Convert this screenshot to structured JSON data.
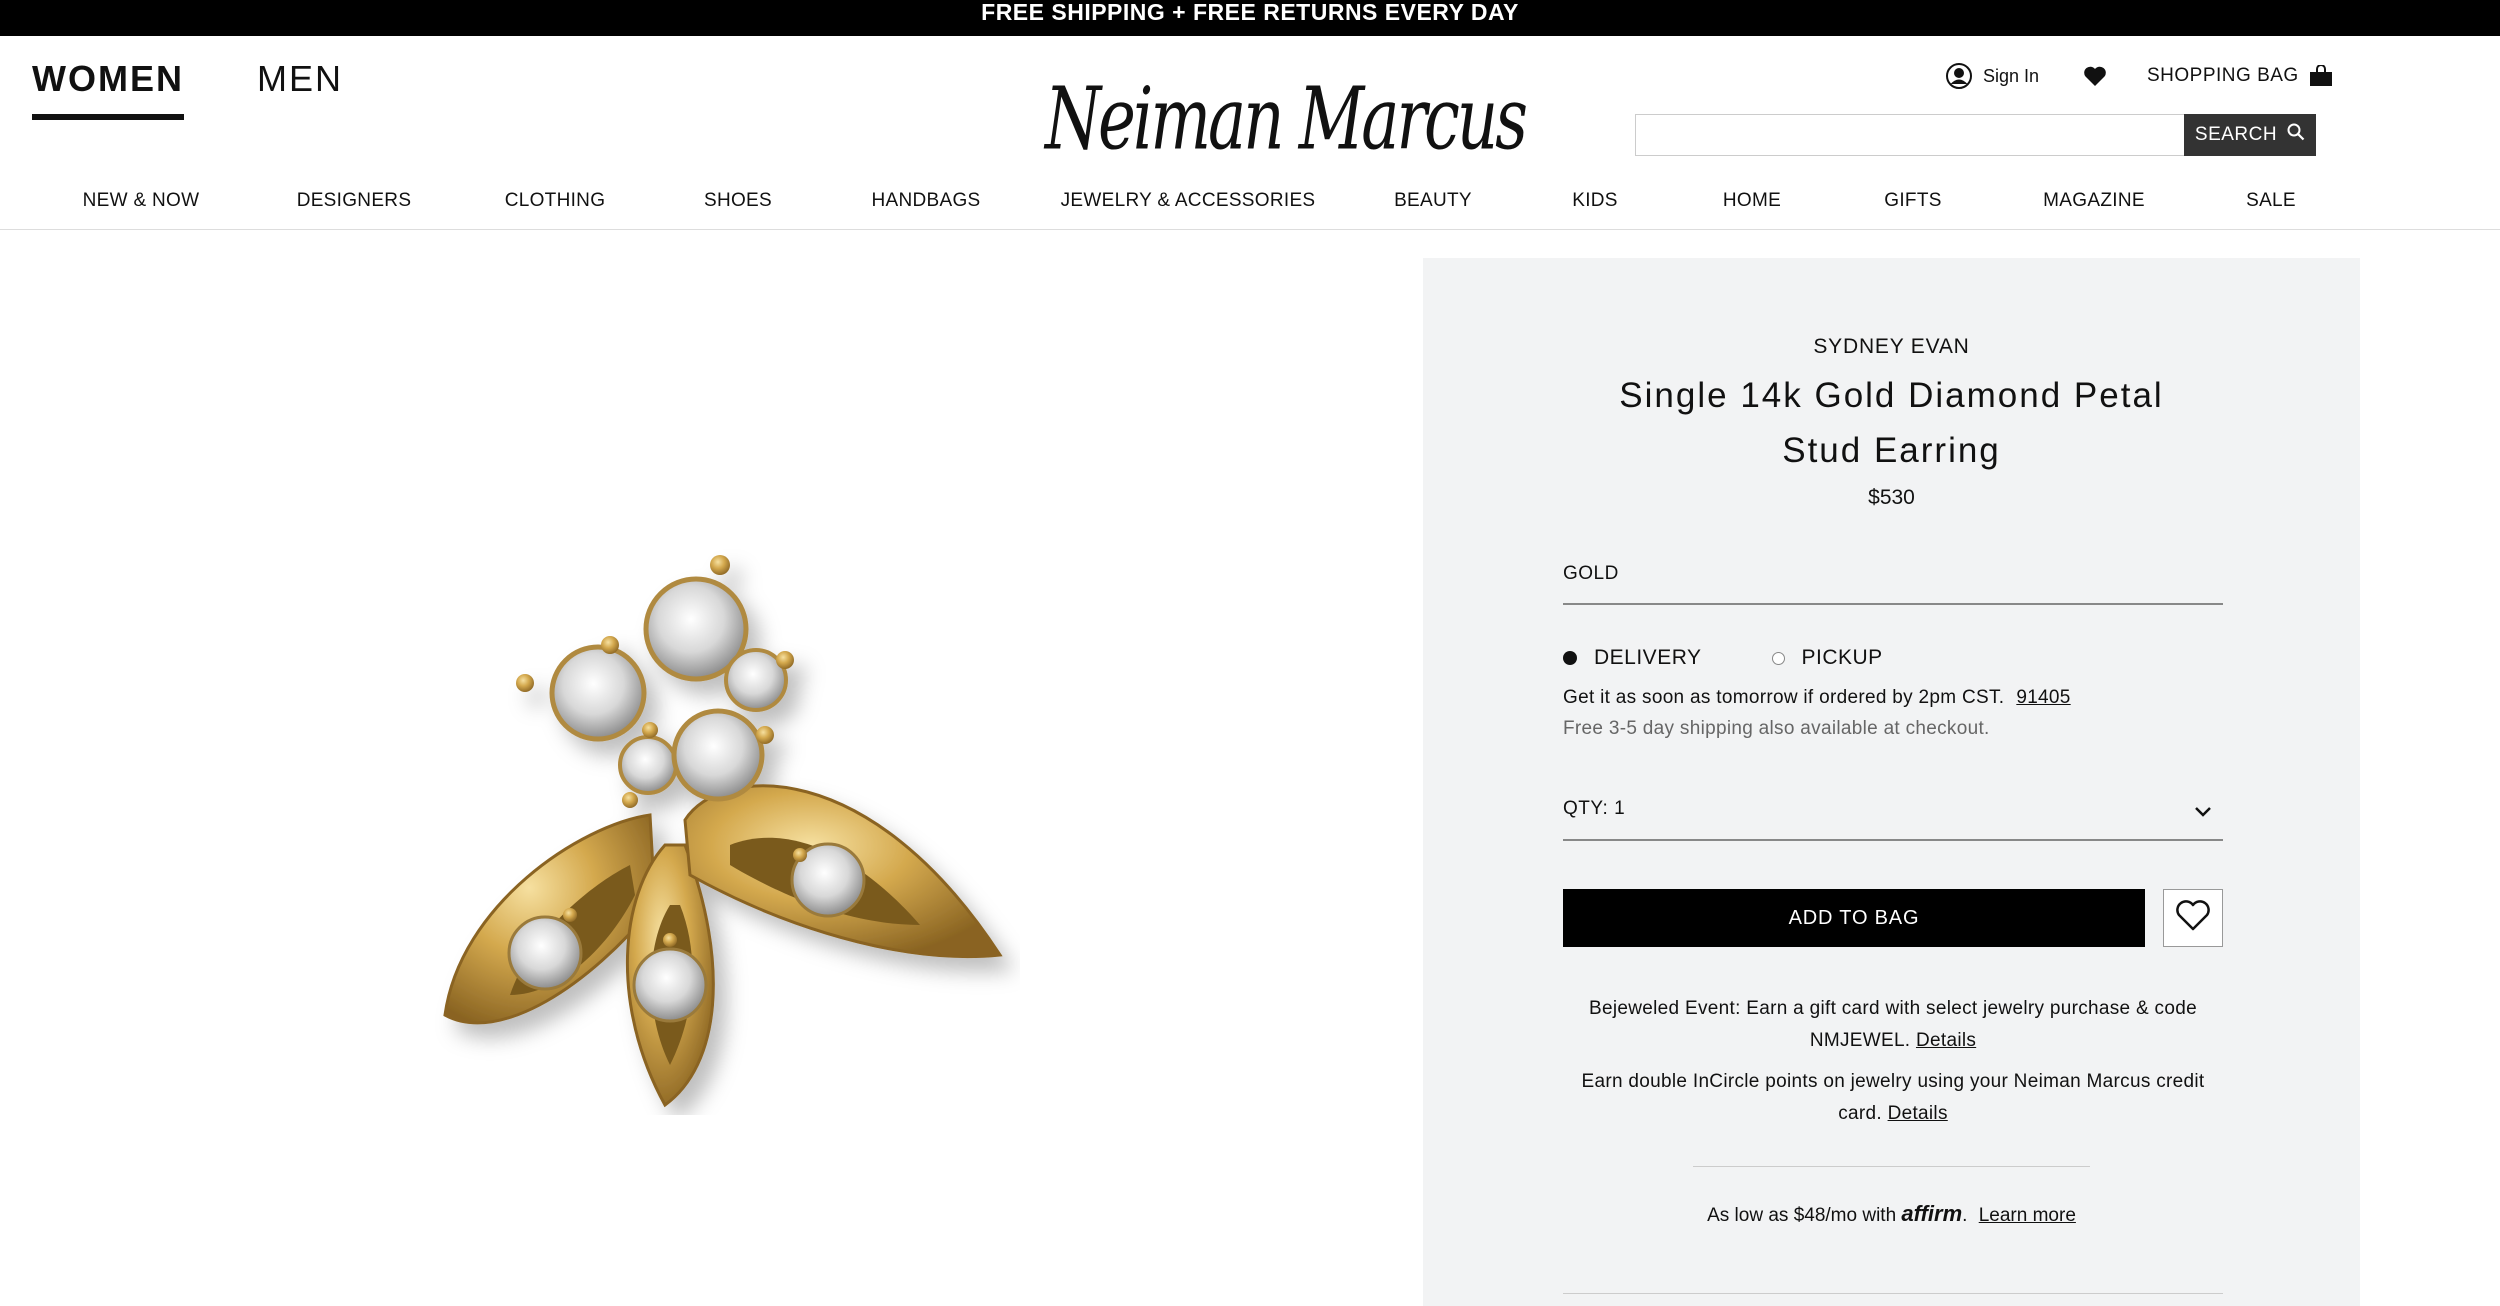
{
  "promo_banner": "FREE SHIPPING + FREE RETURNS EVERY DAY",
  "header": {
    "gender_tabs": [
      {
        "label": "WOMEN"
      },
      {
        "label": "MEN"
      }
    ],
    "logo": "Neiman Marcus",
    "sign_in": "Sign In",
    "shopping_bag": "SHOPPING BAG",
    "search": {
      "placeholder": "",
      "button": "SEARCH"
    }
  },
  "nav": [
    {
      "label": "NEW & NOW"
    },
    {
      "label": "DESIGNERS"
    },
    {
      "label": "CLOTHING"
    },
    {
      "label": "SHOES"
    },
    {
      "label": "HANDBAGS"
    },
    {
      "label": "JEWELRY & ACCESSORIES"
    },
    {
      "label": "BEAUTY"
    },
    {
      "label": "KIDS"
    },
    {
      "label": "HOME"
    },
    {
      "label": "GIFTS"
    },
    {
      "label": "MAGAZINE"
    },
    {
      "label": "SALE"
    }
  ],
  "product": {
    "brand": "SYDNEY EVAN",
    "name": "Single 14k Gold Diamond Petal Stud Earring",
    "price": "$530",
    "color": "GOLD",
    "fulfillment": {
      "delivery": "DELIVERY",
      "pickup": "PICKUP",
      "selected": "DELIVERY"
    },
    "shipping_line": "Get it as soon as tomorrow if ordered by 2pm CST.",
    "zip": "91405",
    "shipping_note": "Free 3-5 day shipping also available at checkout.",
    "qty": "QTY: 1",
    "add_to_bag": "ADD TO BAG"
  },
  "promos": {
    "bejeweled_text": "Bejeweled Event: Earn a gift card with select jewelry purchase & code NMJEWEL.",
    "bejeweled_link": "Details",
    "incircle_text": "Earn double InCircle points on jewelry using your Neiman Marcus credit card.",
    "incircle_link": "Details"
  },
  "affirm": {
    "text": "As low as $48/mo with",
    "brand": "affirm",
    "link": "Learn more"
  },
  "colors": {
    "topbar": "#000000",
    "panel": "#f2f3f4",
    "button": "#000000",
    "search_button": "#333333",
    "gold": "#c9a24a"
  }
}
